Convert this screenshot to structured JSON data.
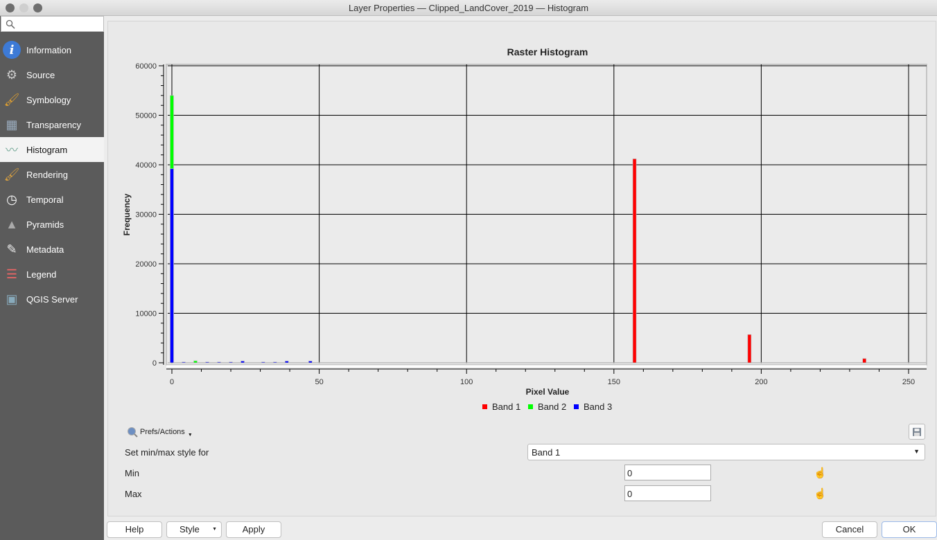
{
  "window": {
    "title": "Layer Properties — Clipped_LandCover_2019 — Histogram"
  },
  "sidebar": {
    "search_placeholder": "",
    "items": [
      {
        "label": "Information",
        "icon": "info-icon"
      },
      {
        "label": "Source",
        "icon": "source-icon"
      },
      {
        "label": "Symbology",
        "icon": "symbology-icon"
      },
      {
        "label": "Transparency",
        "icon": "transparency-icon"
      },
      {
        "label": "Histogram",
        "icon": "histogram-icon",
        "selected": true
      },
      {
        "label": "Rendering",
        "icon": "rendering-icon"
      },
      {
        "label": "Temporal",
        "icon": "clock-icon"
      },
      {
        "label": "Pyramids",
        "icon": "pyramids-icon"
      },
      {
        "label": "Metadata",
        "icon": "metadata-icon"
      },
      {
        "label": "Legend",
        "icon": "legend-icon"
      },
      {
        "label": "QGIS Server",
        "icon": "server-icon"
      }
    ]
  },
  "chart_data": {
    "type": "bar",
    "title": "Raster Histogram",
    "xlabel": "Pixel Value",
    "ylabel": "Frequency",
    "xlim": [
      0,
      255
    ],
    "ylim": [
      0,
      60000
    ],
    "xticks": [
      0,
      50,
      100,
      150,
      200,
      250
    ],
    "yticks": [
      0,
      10000,
      20000,
      30000,
      40000,
      50000,
      60000
    ],
    "grid": true,
    "legend_position": "bottom",
    "series": [
      {
        "name": "Band 1",
        "color": "#ff0000",
        "points": [
          [
            157,
            41200
          ],
          [
            196,
            5700
          ],
          [
            235,
            850
          ]
        ]
      },
      {
        "name": "Band 2",
        "color": "#00ff00",
        "points": [
          [
            0,
            54000
          ],
          [
            8,
            400
          ]
        ]
      },
      {
        "name": "Band 3",
        "color": "#0000ff",
        "points": [
          [
            0,
            39200
          ],
          [
            4,
            150
          ],
          [
            12,
            150
          ],
          [
            16,
            150
          ],
          [
            20,
            150
          ],
          [
            24,
            350
          ],
          [
            31,
            150
          ],
          [
            35,
            150
          ],
          [
            39,
            350
          ],
          [
            47,
            350
          ]
        ]
      }
    ]
  },
  "controls": {
    "prefs_label": "Prefs/Actions",
    "minmax_label": "Set min/max style for",
    "band_select": "Band 1",
    "min_label": "Min",
    "min_value": "0",
    "max_label": "Max",
    "max_value": "0"
  },
  "footer": {
    "help": "Help",
    "style": "Style",
    "apply": "Apply",
    "cancel": "Cancel",
    "ok": "OK"
  }
}
